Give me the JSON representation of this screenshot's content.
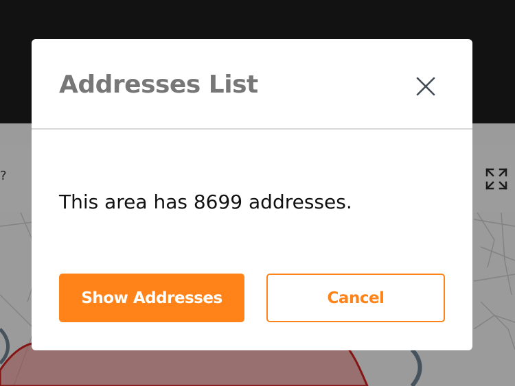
{
  "modal": {
    "title": "Addresses List",
    "message": "This area has 8699 addresses.",
    "primary_button": "Show Addresses",
    "secondary_button": "Cancel",
    "close_icon": "close-icon"
  },
  "map": {
    "expand_icon": "expand-icon",
    "left_glyph": "?"
  },
  "colors": {
    "accent": "#ff8319",
    "title": "#777777",
    "text": "#111111",
    "top_bar": "#1c1c1c",
    "scrim": "rgba(0,0,0,0.35)",
    "area_outline": "#cc1f1f",
    "area_fill": "#e88080"
  }
}
